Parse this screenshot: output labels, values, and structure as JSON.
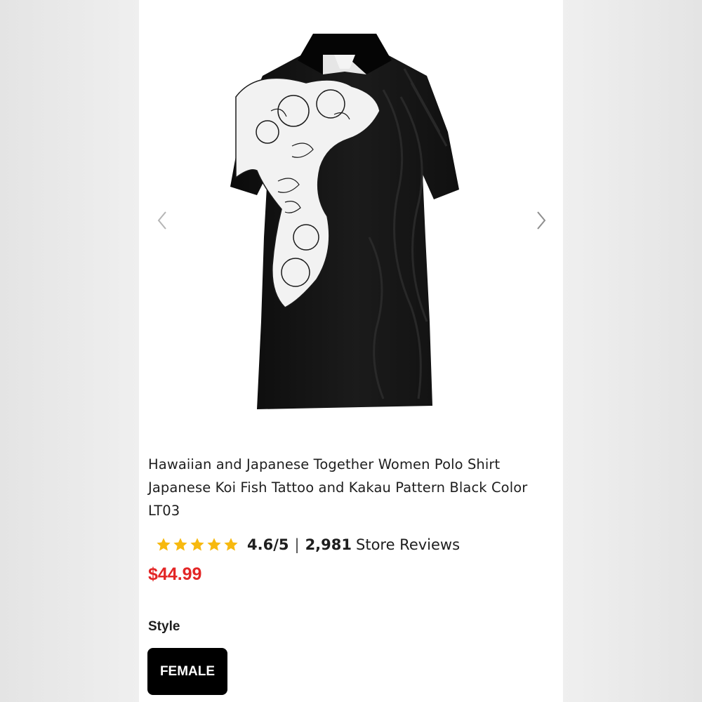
{
  "product": {
    "title": "Hawaiian and Japanese Together Women Polo Shirt Japanese Koi Fish Tattoo and Kakau Pattern Black Color LT03",
    "rating": {
      "stars": 5,
      "value": "4.6/5",
      "separator": "|",
      "review_count": "2,981",
      "review_label": "Store Reviews"
    },
    "price": "$44.99",
    "style": {
      "label": "Style",
      "options": [
        "FEMALE"
      ],
      "selected": "FEMALE"
    }
  },
  "gallery": {
    "prev_icon": "chevron-left-icon",
    "next_icon": "chevron-right-icon"
  },
  "colors": {
    "price": "#e32626",
    "star": "#f7b90f",
    "selected_option_bg": "#000000",
    "shirt": "#141414"
  }
}
